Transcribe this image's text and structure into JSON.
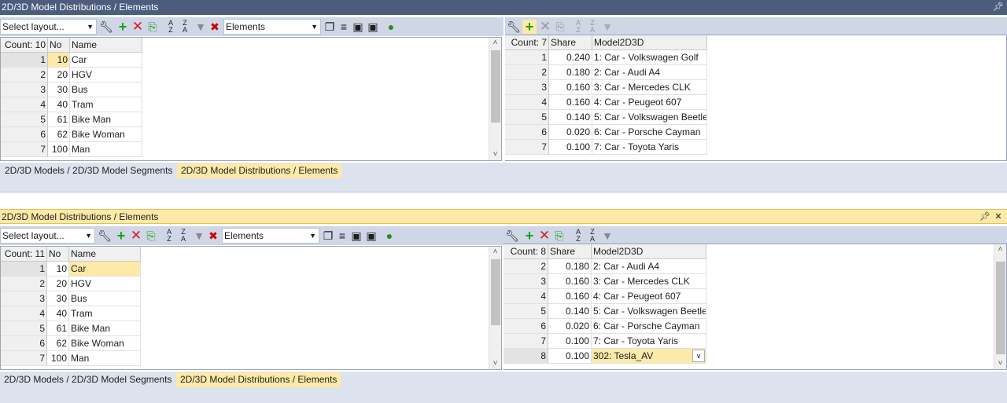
{
  "top_panel": {
    "title": "2D/3D Model Distributions / Elements",
    "layout_select": "Select layout...",
    "list_select": "Elements",
    "left_grid": {
      "count_header": "Count: 10",
      "columns": [
        "No",
        "Name"
      ],
      "rows": [
        {
          "n": "1",
          "no": "10",
          "name": "Car"
        },
        {
          "n": "2",
          "no": "20",
          "name": "HGV"
        },
        {
          "n": "3",
          "no": "30",
          "name": "Bus"
        },
        {
          "n": "4",
          "no": "40",
          "name": "Tram"
        },
        {
          "n": "5",
          "no": "61",
          "name": "Bike Man"
        },
        {
          "n": "6",
          "no": "62",
          "name": "Bike Woman"
        },
        {
          "n": "7",
          "no": "100",
          "name": "Man"
        }
      ]
    },
    "right_grid": {
      "count_header": "Count: 7",
      "columns": [
        "Share",
        "Model2D3D"
      ],
      "rows": [
        {
          "n": "1",
          "share": "0.240",
          "model": "1: Car - Volkswagen Golf"
        },
        {
          "n": "2",
          "share": "0.180",
          "model": "2: Car - Audi A4"
        },
        {
          "n": "3",
          "share": "0.160",
          "model": "3: Car - Mercedes CLK"
        },
        {
          "n": "4",
          "share": "0.160",
          "model": "4: Car - Peugeot 607"
        },
        {
          "n": "5",
          "share": "0.140",
          "model": "5: Car - Volkswagen Beetle"
        },
        {
          "n": "6",
          "share": "0.020",
          "model": "6: Car - Porsche Cayman"
        },
        {
          "n": "7",
          "share": "0.100",
          "model": "7: Car - Toyota Yaris"
        }
      ]
    },
    "tabs": [
      "2D/3D Models / 2D/3D Model Segments",
      "2D/3D Model Distributions / Elements"
    ]
  },
  "bottom_panel": {
    "title": "2D/3D Model Distributions / Elements",
    "layout_select": "Select layout...",
    "list_select": "Elements",
    "left_grid": {
      "count_header": "Count: 11",
      "columns": [
        "No",
        "Name"
      ],
      "rows": [
        {
          "n": "1",
          "no": "10",
          "name": "Car"
        },
        {
          "n": "2",
          "no": "20",
          "name": "HGV"
        },
        {
          "n": "3",
          "no": "30",
          "name": "Bus"
        },
        {
          "n": "4",
          "no": "40",
          "name": "Tram"
        },
        {
          "n": "5",
          "no": "61",
          "name": "Bike Man"
        },
        {
          "n": "6",
          "no": "62",
          "name": "Bike Woman"
        },
        {
          "n": "7",
          "no": "100",
          "name": "Man"
        }
      ]
    },
    "right_grid": {
      "count_header": "Count: 8",
      "columns": [
        "Share",
        "Model2D3D"
      ],
      "rows": [
        {
          "n": "2",
          "share": "0.180",
          "model": "2: Car - Audi A4"
        },
        {
          "n": "3",
          "share": "0.160",
          "model": "3: Car - Mercedes CLK"
        },
        {
          "n": "4",
          "share": "0.160",
          "model": "4: Car - Peugeot 607"
        },
        {
          "n": "5",
          "share": "0.140",
          "model": "5: Car - Volkswagen Beetle"
        },
        {
          "n": "6",
          "share": "0.020",
          "model": "6: Car - Porsche Cayman"
        },
        {
          "n": "7",
          "share": "0.100",
          "model": "7: Car - Toyota Yaris"
        },
        {
          "n": "8",
          "share": "0.100",
          "model": "302: Tesla_AV"
        }
      ]
    },
    "tabs": [
      "2D/3D Models / 2D/3D Model Segments",
      "2D/3D Model Distributions / Elements"
    ]
  },
  "title_buttons": {
    "pin": "ᵾ",
    "close": "✕"
  },
  "icons": [
    "wrench-icon",
    "add-icon",
    "delete-icon",
    "duplicate-icon",
    "sort-az-icon",
    "sort-za-icon",
    "filter-icon",
    "clear-filter-icon",
    "copy-icon",
    "database-icon",
    "save-icon",
    "save-as-icon",
    "user-icon"
  ],
  "colors": {
    "active_title": "#fde9a8",
    "inactive_title": "#4b5c7d",
    "toolbar": "#cfd6e5",
    "selection": "#fde9a8"
  }
}
